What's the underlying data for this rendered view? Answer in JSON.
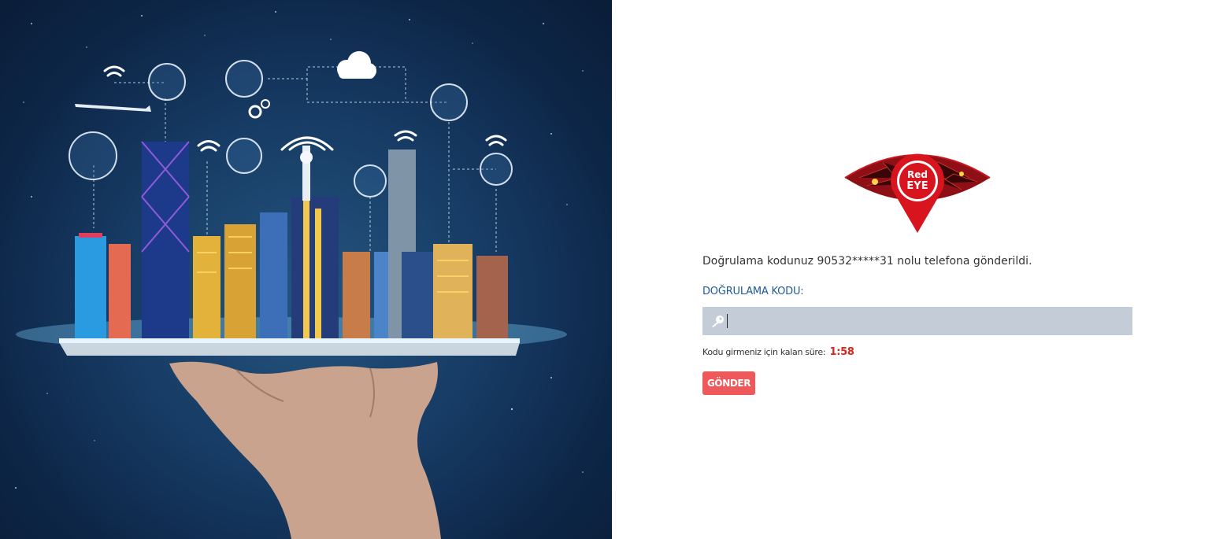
{
  "hero": {
    "image": "smart-city-on-tablet-illustration"
  },
  "logo": {
    "line1": "Red",
    "line2": "EYE"
  },
  "verification": {
    "sent_message": "Doğrulama kodunuz 90532*****31 nolu telefona gönderildi.",
    "code_label": "DOĞRULAMA KODU:",
    "code_value": "",
    "timer_label": "Kodu girmeniz için kalan süre:",
    "timer_value": "1:58",
    "submit_label": "GÖNDER"
  },
  "colors": {
    "label_blue": "#1f5a91",
    "input_bg": "#c4ccd8",
    "timer_red": "#d9261c",
    "button_red": "#ee5a5c",
    "logo_red": "#b3121a"
  }
}
